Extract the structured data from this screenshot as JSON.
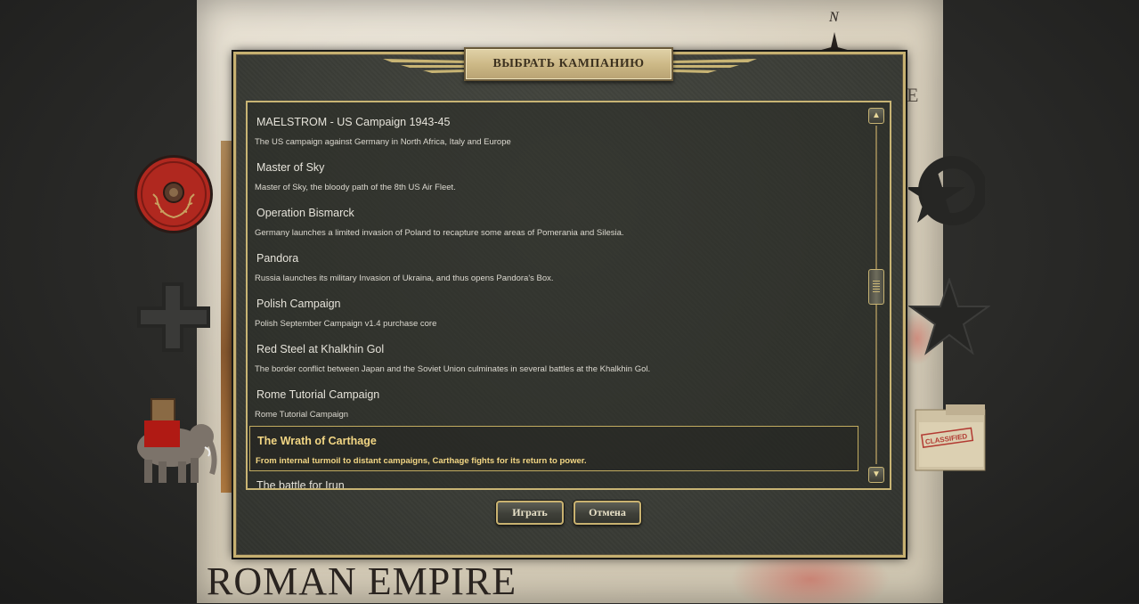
{
  "background": {
    "map_title": "ROMAN EMPIRE",
    "map_letter": "E",
    "compass_label": "N",
    "folder_stamp": "CLASSIFIED"
  },
  "dialog": {
    "title": "ВЫБРАТЬ КАМПАНИЮ",
    "campaigns": [
      {
        "name": "MAELSTROM - US Campaign 1943-45",
        "description": "The US campaign against Germany in North Africa, Italy and Europe",
        "selected": false
      },
      {
        "name": "Master of Sky",
        "description": "Master of Sky, the bloody path of the 8th US Air Fleet.",
        "selected": false
      },
      {
        "name": "Operation Bismarck",
        "description": "Germany launches a limited invasion of Poland to recapture some areas of Pomerania and Silesia.",
        "selected": false
      },
      {
        "name": "Pandora",
        "description": "Russia launches its military Invasion of Ukraina, and thus opens Pandora's Box.",
        "selected": false
      },
      {
        "name": "Polish Campaign",
        "description": "Polish September Campaign v1.4 purchase core",
        "selected": false
      },
      {
        "name": "Red Steel at Khalkhin Gol",
        "description": "The border conflict between Japan and the Soviet Union culminates in several battles at the Khalkhin Gol.",
        "selected": false
      },
      {
        "name": "Rome Tutorial Campaign",
        "description": "Rome Tutorial Campaign",
        "selected": false
      },
      {
        "name": "The Wrath of Carthage",
        "description": "From internal turmoil to distant campaigns, Carthage fights for its return to power.",
        "selected": true
      },
      {
        "name": "The battle for Irun",
        "description": "",
        "selected": false
      }
    ],
    "play_label": "Играть",
    "cancel_label": "Отмена"
  },
  "colors": {
    "frame_gold": "#c8b474",
    "selected_text": "#f2d684",
    "dialog_bg": "#3b3d37"
  }
}
